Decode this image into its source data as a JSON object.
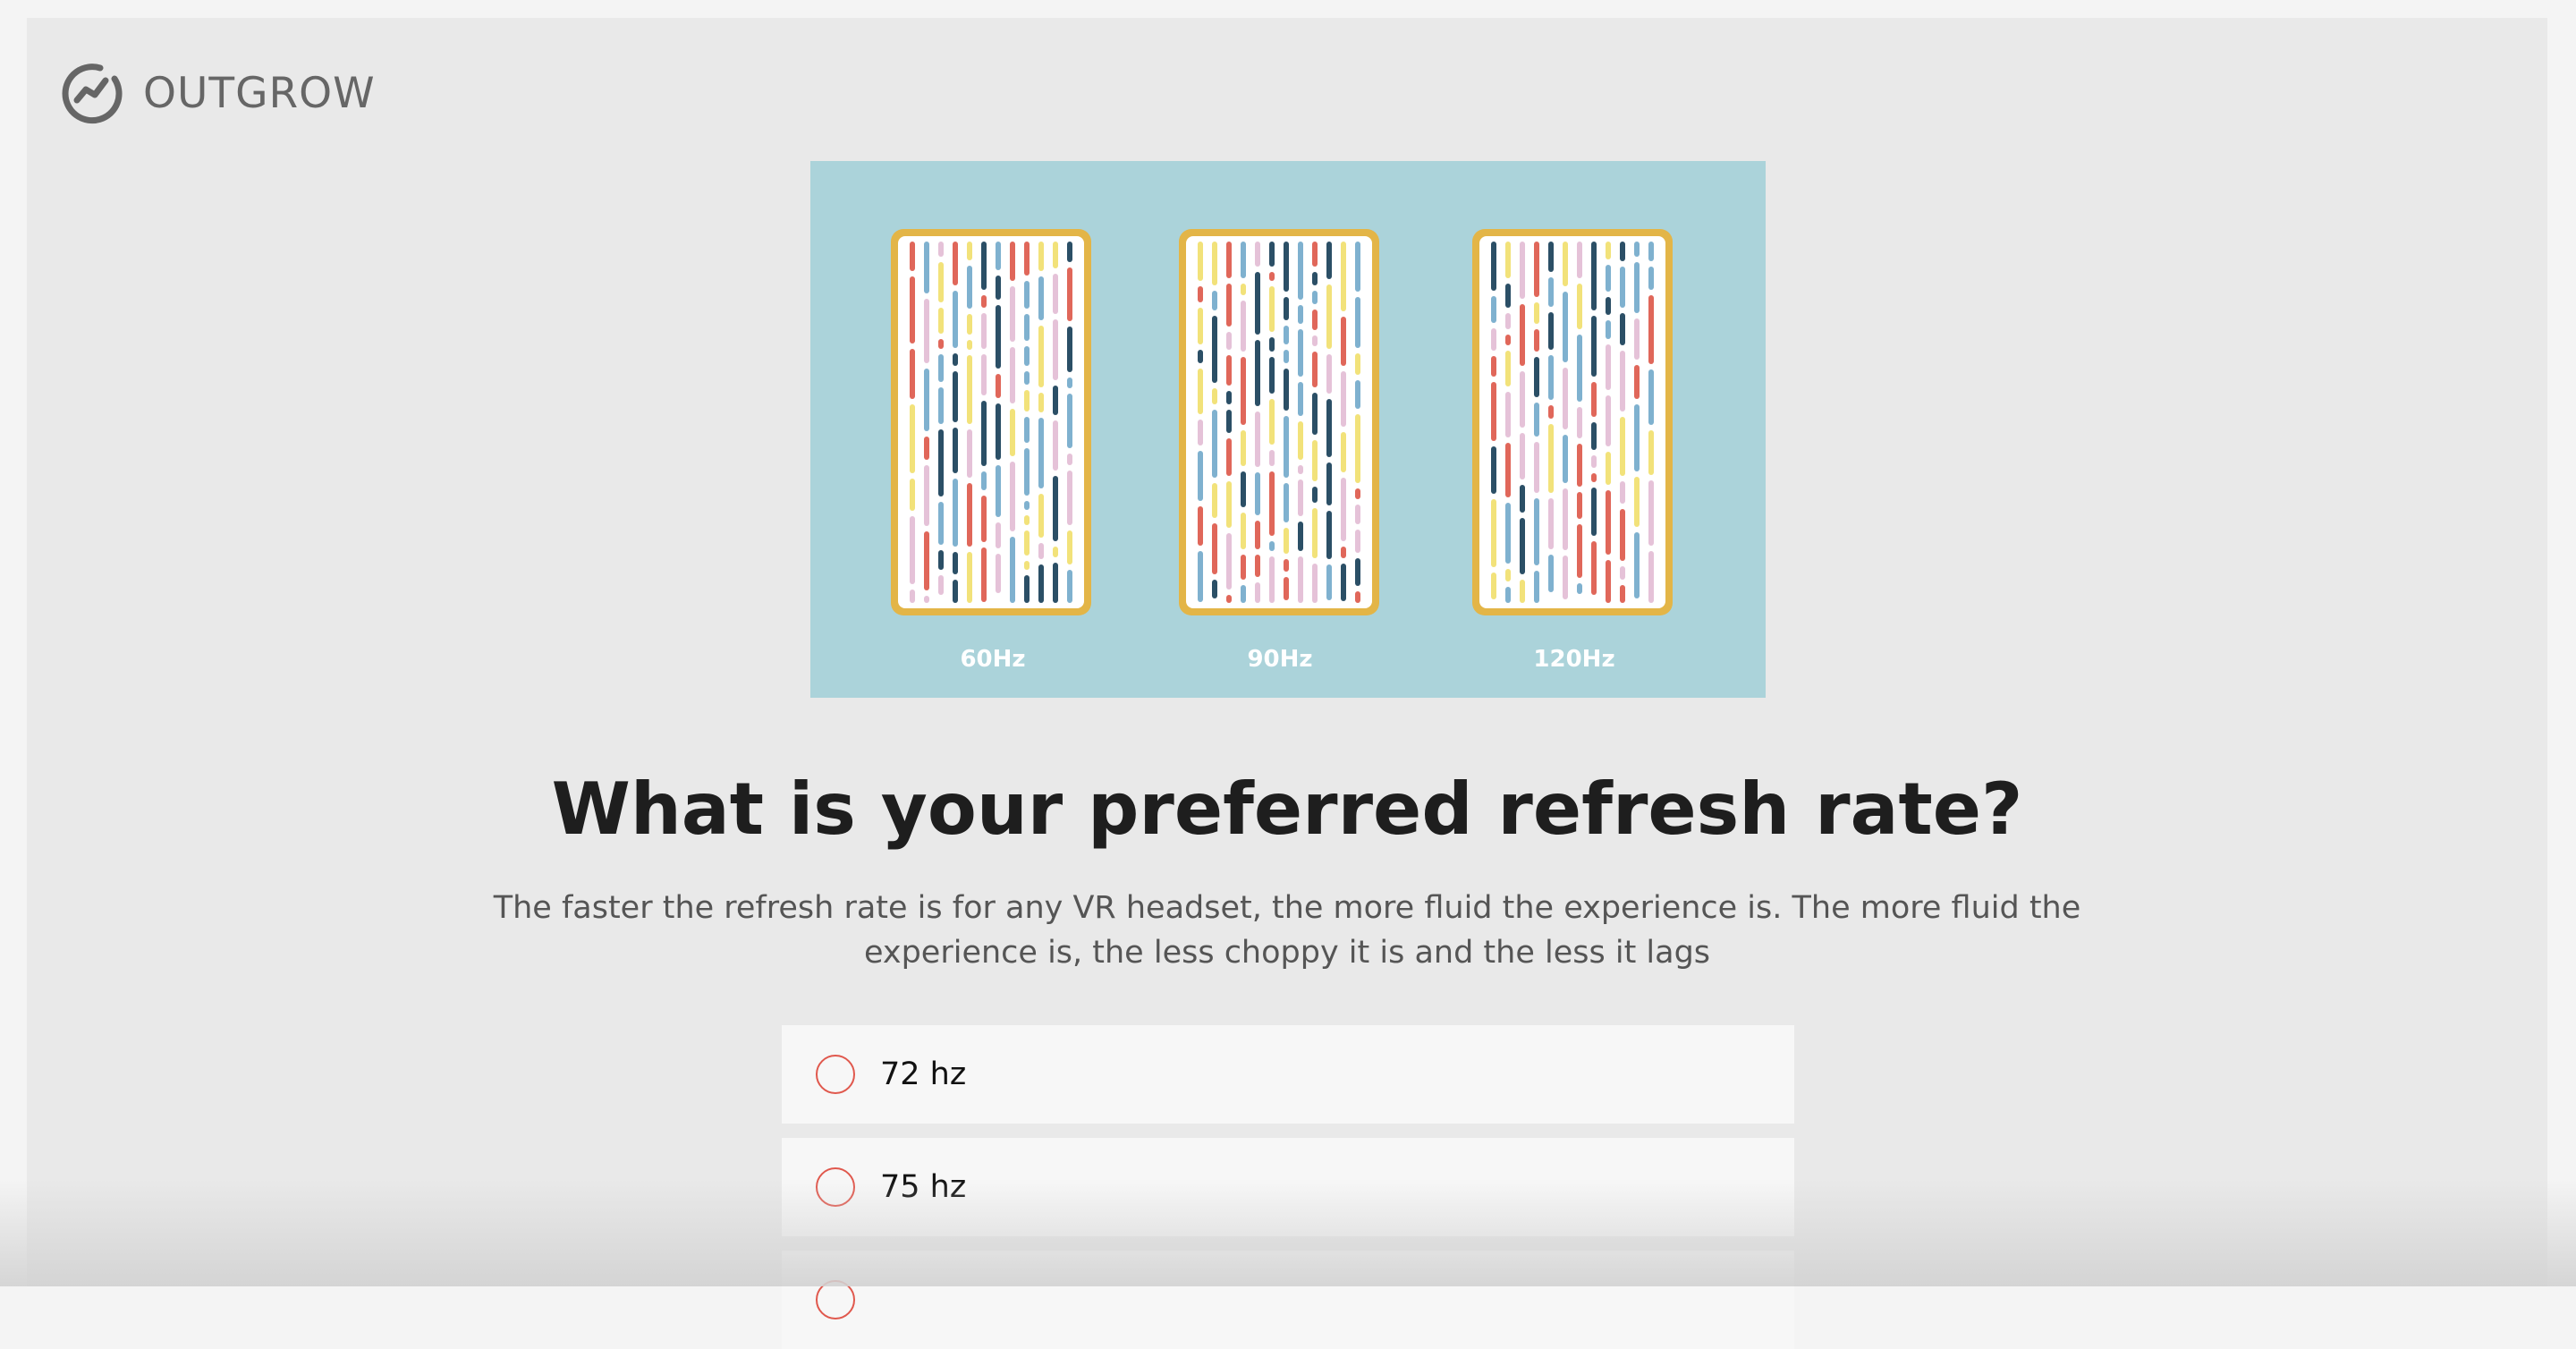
{
  "brand": {
    "logo_icon": "outgrow-logo-icon",
    "name": "OUTGROW"
  },
  "hero": {
    "icon": "refresh-rate-illustration",
    "labels": [
      "60Hz",
      "90Hz",
      "120Hz"
    ],
    "colors": {
      "background": "#abd3da",
      "frame": "#e3b547"
    }
  },
  "question": {
    "title": "What is your preferred refresh rate?",
    "description": "The faster the refresh rate is for any VR headset, the more fluid the experience is. The more fluid the experience is, the less choppy it is and the less it lags"
  },
  "options": [
    {
      "label": "72 hz"
    },
    {
      "label": "75 hz"
    },
    {
      "label": ""
    }
  ],
  "colors": {
    "accent": "#e0584d",
    "page_bg": "#e9e9e9",
    "option_bg": "#f7f7f7"
  }
}
